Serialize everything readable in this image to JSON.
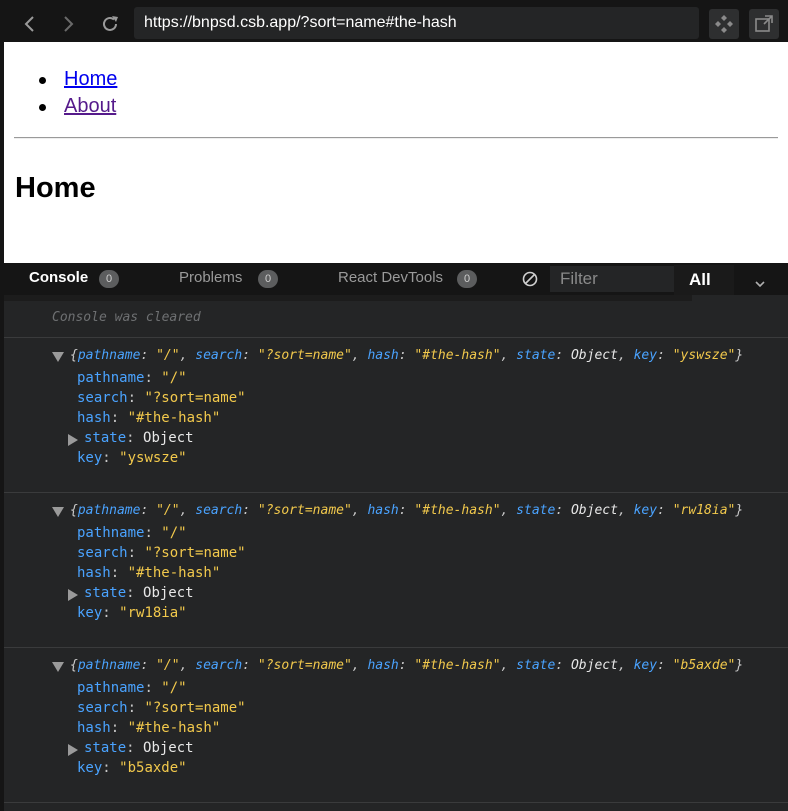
{
  "browser": {
    "url": "https://bnpsd.csb.app/?sort=name#the-hash"
  },
  "preview": {
    "nav": [
      {
        "label": "Home"
      },
      {
        "label": "About"
      }
    ],
    "heading": "Home"
  },
  "console": {
    "tabs": [
      {
        "label": "Console",
        "count": "0"
      },
      {
        "label": "Problems",
        "count": "0"
      },
      {
        "label": "React DevTools",
        "count": "0"
      }
    ],
    "filter_placeholder": "Filter",
    "level_selected": "All",
    "cleared_message": "Console was cleared",
    "entries": [
      {
        "summary_open": "{",
        "pathname": "\"/\"",
        "search": "\"?sort=name\"",
        "hash": "\"#the-hash\"",
        "state": "Object",
        "key": "\"yswsze\"",
        "summary_close": "}"
      },
      {
        "summary_open": "{",
        "pathname": "\"/\"",
        "search": "\"?sort=name\"",
        "hash": "\"#the-hash\"",
        "state": "Object",
        "key": "\"rw18ia\"",
        "summary_close": "}"
      },
      {
        "summary_open": "{",
        "pathname": "\"/\"",
        "search": "\"?sort=name\"",
        "hash": "\"#the-hash\"",
        "state": "Object",
        "key": "\"b5axde\"",
        "summary_close": "}"
      }
    ],
    "labels": {
      "pathname": "pathname",
      "search": "search",
      "hash": "hash",
      "state": "state",
      "key": "key",
      "colon": ": ",
      "comma": ", "
    }
  },
  "colors": {
    "key": "#4aa3ff",
    "string": "#f2c94c",
    "panel": "#242526",
    "toolbar": "#151515"
  }
}
